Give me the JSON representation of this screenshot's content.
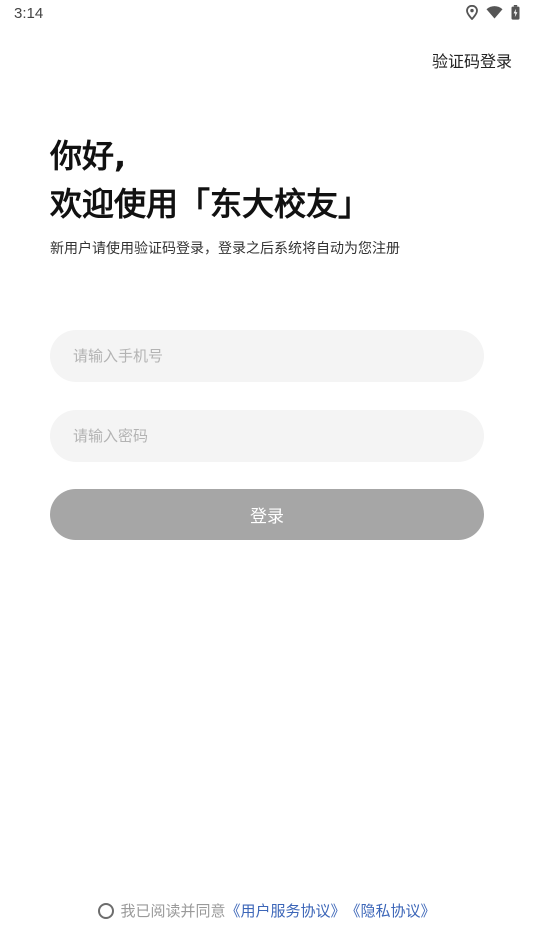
{
  "status_bar": {
    "time": "3:14",
    "icons": [
      "location-icon",
      "wifi-icon",
      "battery-icon"
    ]
  },
  "header": {
    "code_login_label": "验证码登录"
  },
  "greeting": {
    "line1": "你好,",
    "line2": "欢迎使用「东大校友」",
    "subtitle": "新用户请使用验证码登录，登录之后系统将自动为您注册"
  },
  "form": {
    "phone_placeholder": "请输入手机号",
    "phone_value": "",
    "password_placeholder": "请输入密码",
    "password_value": "",
    "login_label": "登录"
  },
  "agreement": {
    "checked": false,
    "prefix": "我已阅读并同意",
    "user_agreement": "《用户服务协议》",
    "privacy_policy": "《隐私协议》"
  },
  "colors": {
    "button_disabled": "#a6a6a6",
    "field_bg": "#f4f4f4",
    "link": "#3c66b8"
  }
}
